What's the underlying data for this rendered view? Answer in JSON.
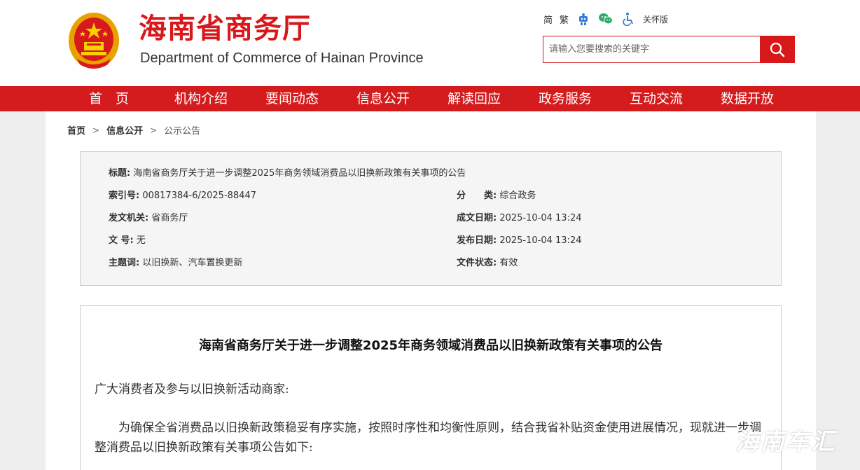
{
  "header": {
    "title_cn": "海南省商务厅",
    "title_en": "Department of Commerce of Hainan Province",
    "lang_simplified": "简",
    "lang_traditional": "繁",
    "care_mode": "关怀版",
    "search_placeholder": "请输入您要搜索的关键字"
  },
  "nav": {
    "items": [
      {
        "label": "首　页"
      },
      {
        "label": "机构介绍"
      },
      {
        "label": "要闻动态"
      },
      {
        "label": "信息公开"
      },
      {
        "label": "解读回应"
      },
      {
        "label": "政务服务"
      },
      {
        "label": "互动交流"
      },
      {
        "label": "数据开放"
      }
    ]
  },
  "breadcrumb": {
    "home": "首页",
    "level1": "信息公开",
    "current": "公示公告",
    "sep": ">"
  },
  "meta": {
    "title_label": "标题:",
    "title_value": "海南省商务厅关于进一步调整2025年商务领域消费品以旧换新政策有关事项的公告",
    "index_label": "索引号:",
    "index_value": "00817384-6/2025-88447",
    "category_label": "分　　类:",
    "category_value": "综合政务",
    "issuer_label": "发文机关:",
    "issuer_value": "省商务厅",
    "created_label": "成文日期:",
    "created_value": "2025-10-04 13:24",
    "docno_label": "文  号:",
    "docno_value": "无",
    "published_label": "发布日期:",
    "published_value": "2025-10-04 13:24",
    "keywords_label": "主题词:",
    "keywords_value": "以旧换新、汽车置换更新",
    "status_label": "文件状态:",
    "status_value": "有效"
  },
  "article": {
    "title": "海南省商务厅关于进一步调整2025年商务领域消费品以旧换新政策有关事项的公告",
    "salutation": "广大消费者及参与以旧换新活动商家:",
    "paragraph1": "为确保全省消费品以旧换新政策稳妥有序实施，按照时序性和均衡性原则，结合我省补贴资金使用进展情况，现就进一步调整消费品以旧换新政策有关事项公告如下:"
  },
  "watermark": "海南车汇",
  "colors": {
    "brand_red": "#d41c1e",
    "title_red": "#d7191c"
  }
}
